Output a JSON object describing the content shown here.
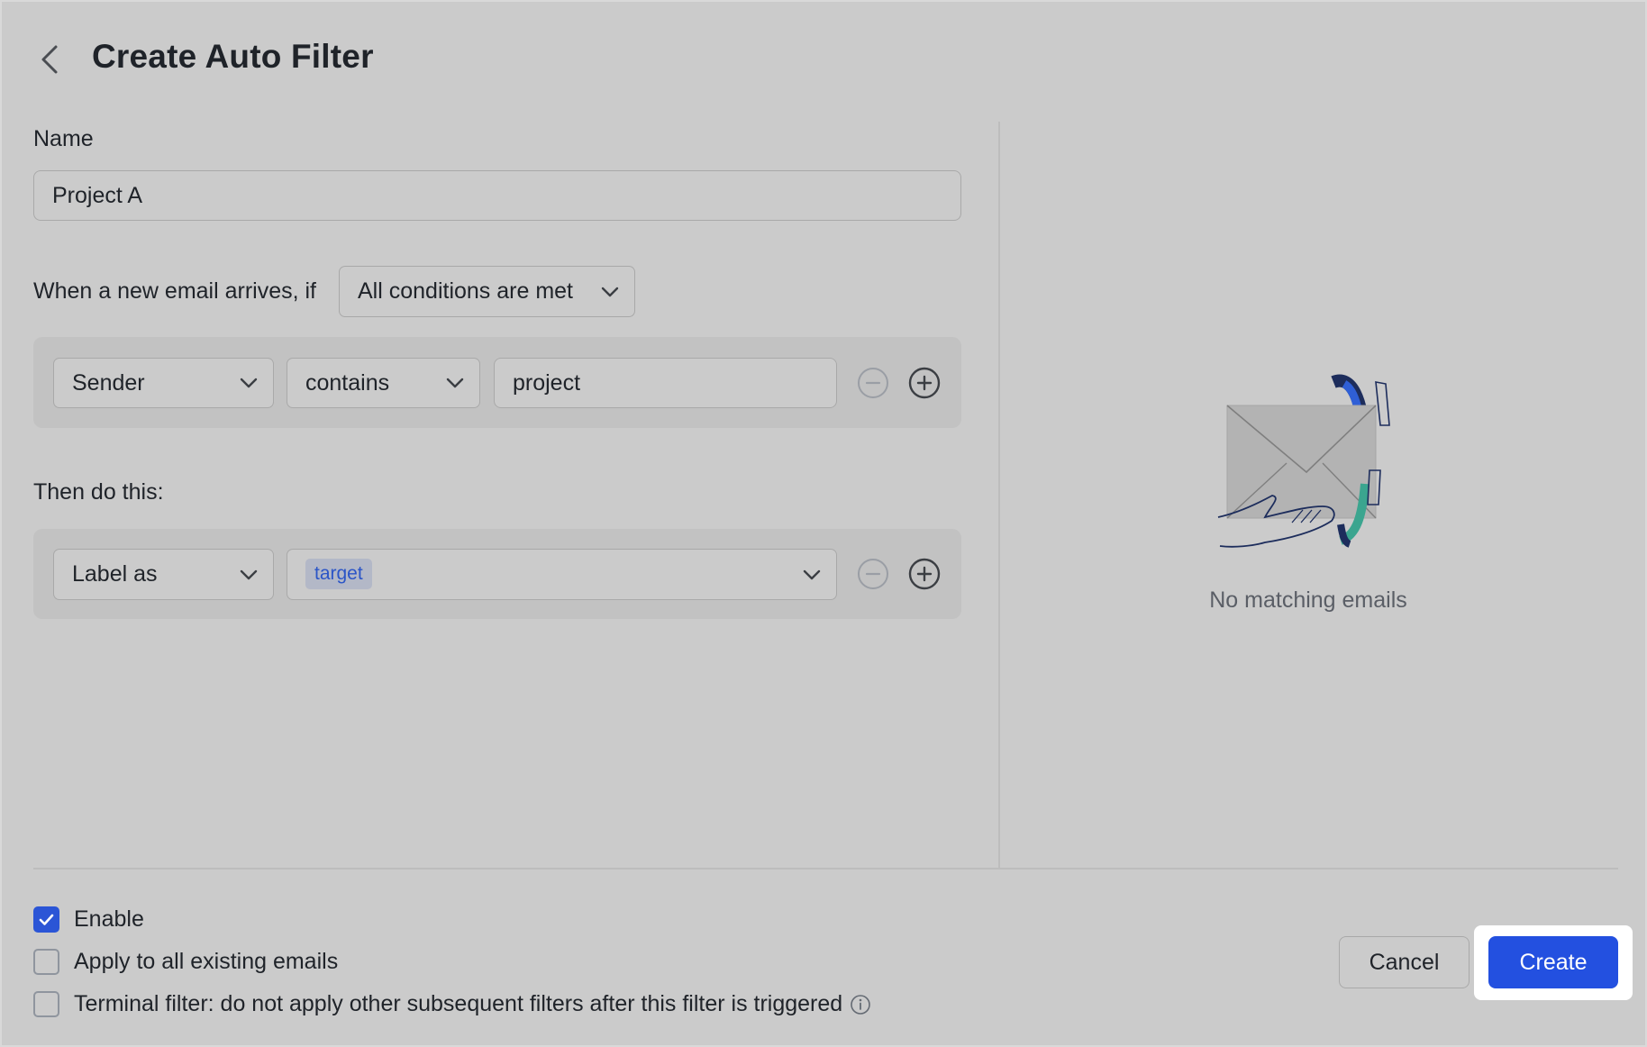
{
  "header": {
    "title": "Create Auto Filter",
    "back_icon": "chevron-left-icon"
  },
  "name_field": {
    "label": "Name",
    "value": "Project A"
  },
  "condition": {
    "prefix": "When a new email arrives, if",
    "match_mode": "All conditions are met",
    "rules": [
      {
        "field": "Sender",
        "operator": "contains",
        "value": "project"
      }
    ]
  },
  "actions": {
    "heading": "Then do this:",
    "items": [
      {
        "type": "Label as",
        "labels": [
          "target"
        ]
      }
    ]
  },
  "preview": {
    "empty_text": "No matching emails"
  },
  "footer": {
    "options": [
      {
        "label": "Enable",
        "checked": true
      },
      {
        "label": "Apply to all existing emails",
        "checked": false
      },
      {
        "label": "Terminal filter: do not apply other subsequent filters after this filter is triggered",
        "checked": false
      }
    ],
    "cancel_label": "Cancel",
    "create_label": "Create"
  },
  "colors": {
    "accent": "#2350e0",
    "tag_text": "#2b55c7",
    "tag_bg": "#b3b8c7",
    "background": "#cbcbcb",
    "panel": "#c2c2c2"
  }
}
